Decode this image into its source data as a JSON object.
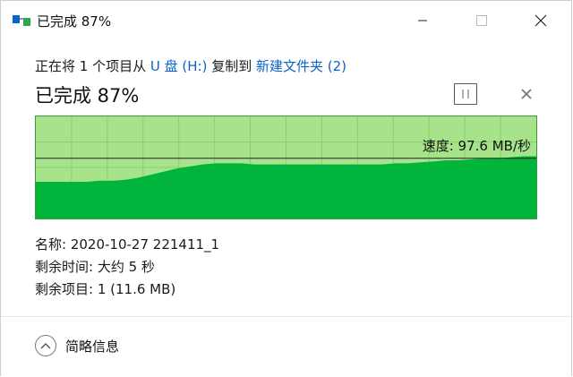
{
  "window": {
    "title": "已完成 87%",
    "partial_background_text": "...",
    "buttons": {
      "minimize": "minimize",
      "maximize": "maximize",
      "close": "close"
    }
  },
  "transfer": {
    "prefix": "正在将 1 个项目从",
    "source": "U 盘 (H:)",
    "middle": "复制到",
    "destination": "新建文件夹 (2)"
  },
  "progress": {
    "title": "已完成 87%",
    "percent": 87
  },
  "graph": {
    "speed_label": "速度: 97.6 MB/秒",
    "colors": {
      "background": "#a6e38b",
      "fill": "#00b43c",
      "line": "#222222",
      "grid": "#8bd06d"
    },
    "speed_line_fraction": 0.59,
    "history_fraction": [
      0.36,
      0.36,
      0.36,
      0.36,
      0.36,
      0.37,
      0.37,
      0.38,
      0.4,
      0.43,
      0.46,
      0.49,
      0.51,
      0.53,
      0.54,
      0.54,
      0.54,
      0.53,
      0.53,
      0.53,
      0.53,
      0.53,
      0.53,
      0.53,
      0.53,
      0.53,
      0.53,
      0.53,
      0.54,
      0.54,
      0.55,
      0.56,
      0.57,
      0.57,
      0.58,
      0.59,
      0.59,
      0.6,
      0.61,
      0.61
    ]
  },
  "details": {
    "name_label": "名称:",
    "name_value": "2020-10-27 221411_1",
    "time_label": "剩余时间:",
    "time_value": "大约 5 秒",
    "items_label": "剩余项目:",
    "items_value": "1 (11.6 MB)"
  },
  "footer": {
    "less_details": "简略信息"
  },
  "icons": {
    "app": "copy-transfer-icon",
    "pause": "pause-icon",
    "cancel": "close-icon",
    "collapse": "chevron-up-icon"
  }
}
